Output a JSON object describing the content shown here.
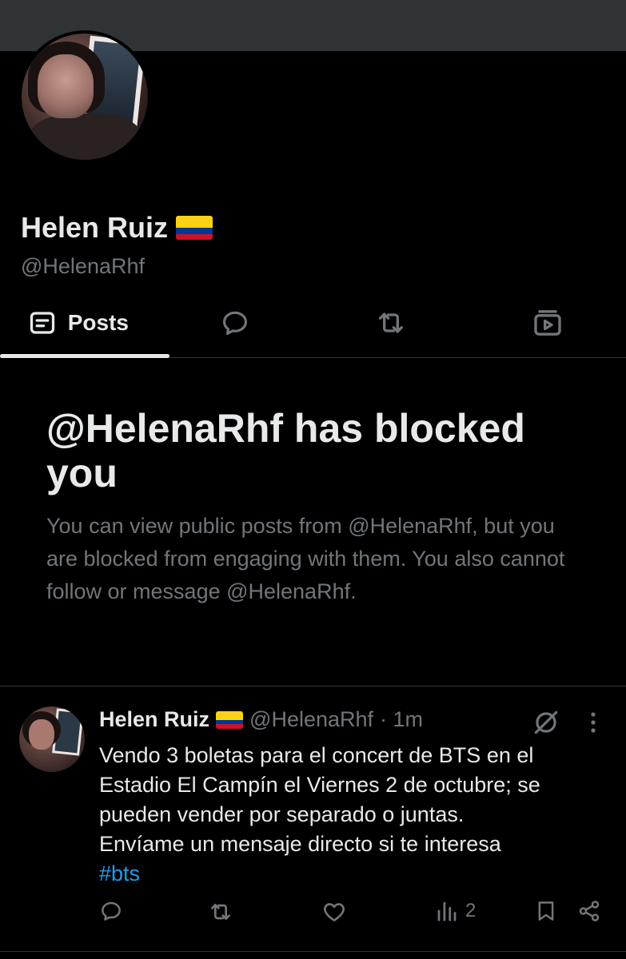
{
  "profile": {
    "display_name": "Helen Ruiz",
    "handle": "@HelenaRhf",
    "flag": "colombia-flag"
  },
  "tabs": [
    {
      "label": "Posts",
      "icon": "posts-icon",
      "active": true
    },
    {
      "label": "",
      "icon": "replies-icon",
      "active": false
    },
    {
      "label": "",
      "icon": "repost-icon",
      "active": false
    },
    {
      "label": "",
      "icon": "media-icon",
      "active": false
    }
  ],
  "blocked_notice": {
    "title": "@HelenaRhf has blocked you",
    "description": "You can view public posts from @HelenaRhf, but you are blocked from engaging with them. You also cannot follow or message @HelenaRhf."
  },
  "post": {
    "author_name": "Helen Ruiz",
    "author_handle": "@HelenaRhf",
    "time": "· 1m",
    "text_lines": [
      "Vendo 3 boletas para el concert de BTS en el",
      "Estadio El Campín el Viernes 2 de octubre; se",
      "pueden vender por separado o juntas.",
      "Envíame un mensaje directo si te interesa"
    ],
    "hashtag": "#bts",
    "views": "2"
  },
  "colors": {
    "background": "#000000",
    "text_primary": "#e7e9ea",
    "text_secondary": "#71767b",
    "link": "#1d9bf0",
    "border": "#2f3336"
  }
}
